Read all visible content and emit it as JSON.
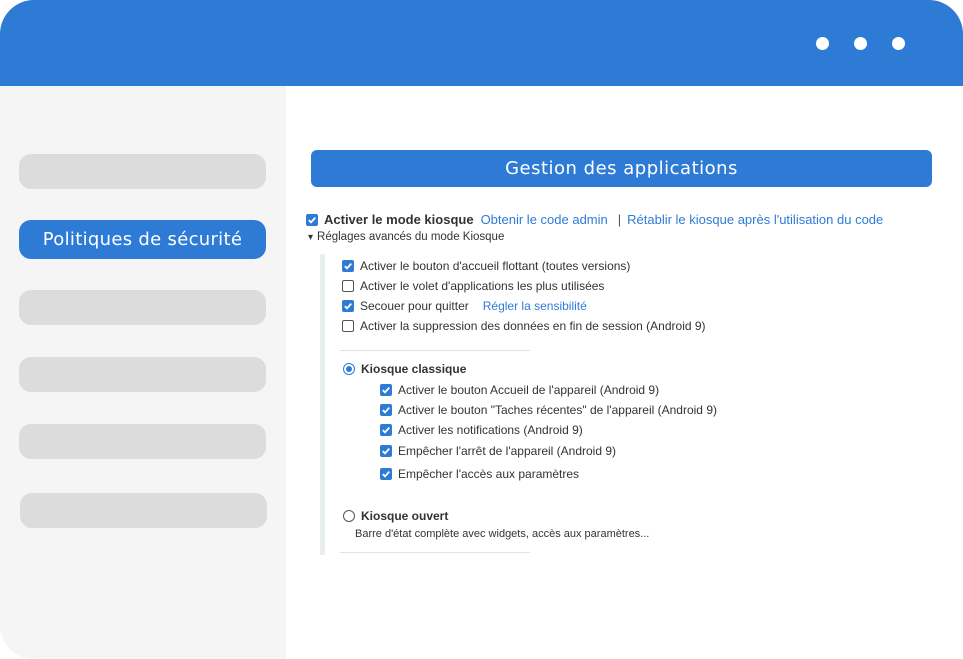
{
  "colors": {
    "accent": "#2e7bd6",
    "sidebar_bg": "#f5f5f5",
    "nav_idle": "#dcdcdc"
  },
  "titlebar": {
    "dots": [
      "dot",
      "dot",
      "dot"
    ]
  },
  "sidebar": {
    "active_label": "Politiques de sécurité"
  },
  "main": {
    "header_title": "Gestion des applications",
    "kiosk_mode": {
      "checked": true,
      "label": "Activer le mode kiosque",
      "admin_link": "Obtenir le code admin",
      "separator": "|",
      "reset_link": "Rétablir le kiosque après l'utilisation du code"
    },
    "advanced_toggle": {
      "arrow": "▾",
      "label": "Réglages avancés du mode Kiosque"
    },
    "options": [
      {
        "checked": true,
        "label": "Activer le bouton d'accueil flottant (toutes versions)"
      },
      {
        "checked": false,
        "label": "Activer le volet d'applications les plus utilisées"
      },
      {
        "checked": true,
        "label": "Secouer pour quitter",
        "link": "Régler la sensibilité"
      },
      {
        "checked": false,
        "label": "Activer la suppression des données en fin de session (Android 9)"
      }
    ],
    "classic_kiosk": {
      "selected": true,
      "label": "Kiosque classique",
      "options": [
        {
          "checked": true,
          "label": "Activer le bouton Accueil de l'appareil (Android 9)"
        },
        {
          "checked": true,
          "label": "Activer le bouton \"Taches récentes\" de l'appareil (Android 9)"
        },
        {
          "checked": true,
          "label": "Activer les notifications (Android 9)"
        },
        {
          "checked": true,
          "label": "Empêcher l'arrêt de l'appareil (Android 9)"
        },
        {
          "checked": true,
          "label": "Empêcher l'accès aux paramètres"
        }
      ]
    },
    "open_kiosk": {
      "selected": false,
      "label": "Kiosque ouvert",
      "description": "Barre d'état complète avec widgets, accès aux paramètres..."
    }
  }
}
